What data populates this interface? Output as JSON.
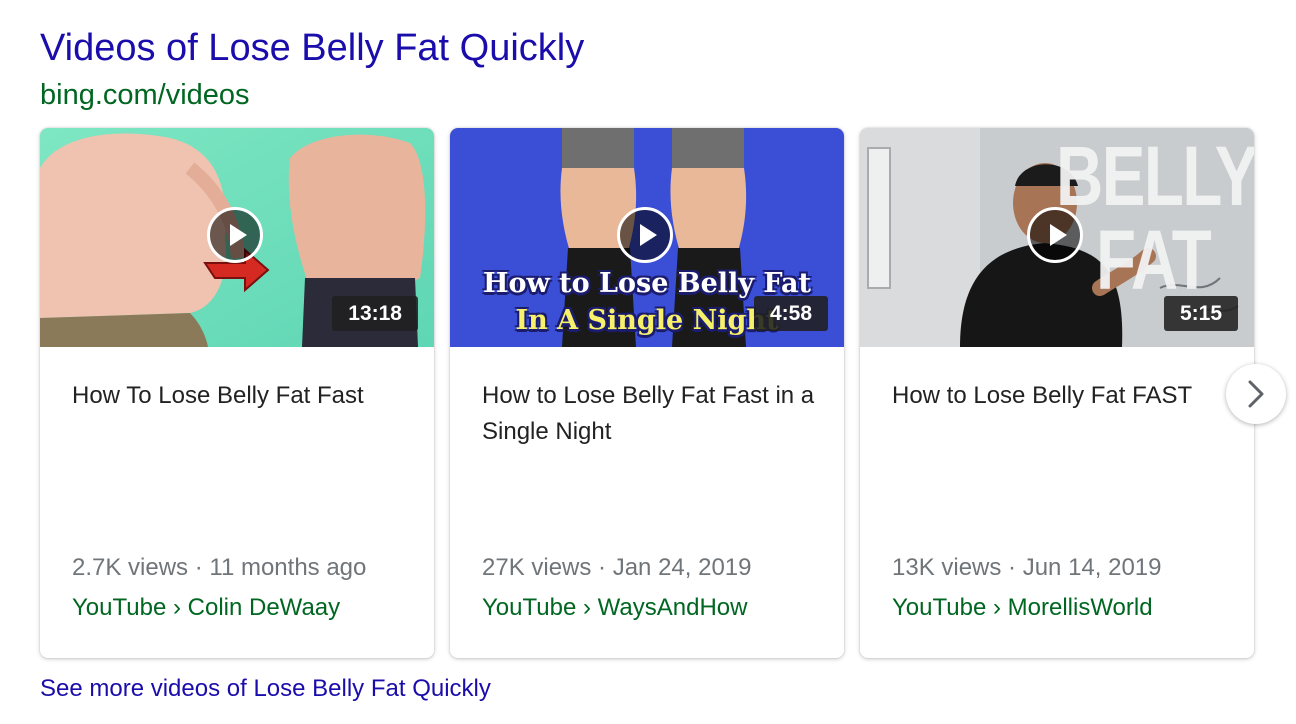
{
  "header": {
    "title": "Videos of Lose Belly Fat Quickly",
    "url": "bing.com/videos"
  },
  "videos": [
    {
      "title": "How To Lose Belly Fat Fast",
      "duration": "13:18",
      "meta": "2.7K views · 11 months ago",
      "source": "YouTube › Colin DeWaay",
      "thumbnail_overlay": []
    },
    {
      "title": "How to Lose Belly Fat Fast in a Single Night",
      "duration": "4:58",
      "meta": "27K views · Jan 24, 2019",
      "source": "YouTube › WaysAndHow",
      "thumbnail_overlay": [
        "How to Lose Belly Fat",
        "In A Single Night"
      ]
    },
    {
      "title": "How to Lose Belly Fat FAST",
      "duration": "5:15",
      "meta": "13K views · Jun 14, 2019",
      "source": "YouTube › MorellisWorld",
      "thumbnail_overlay": [
        "BELLY",
        "FAT"
      ]
    }
  ],
  "see_more": "See more videos of Lose Belly Fat Quickly",
  "icons": {
    "play": "play-icon",
    "next": "chevron-right-icon"
  },
  "colors": {
    "link": "#1a0dab",
    "url_green": "#006621",
    "meta_gray": "#70757a",
    "title_text": "#222222"
  }
}
